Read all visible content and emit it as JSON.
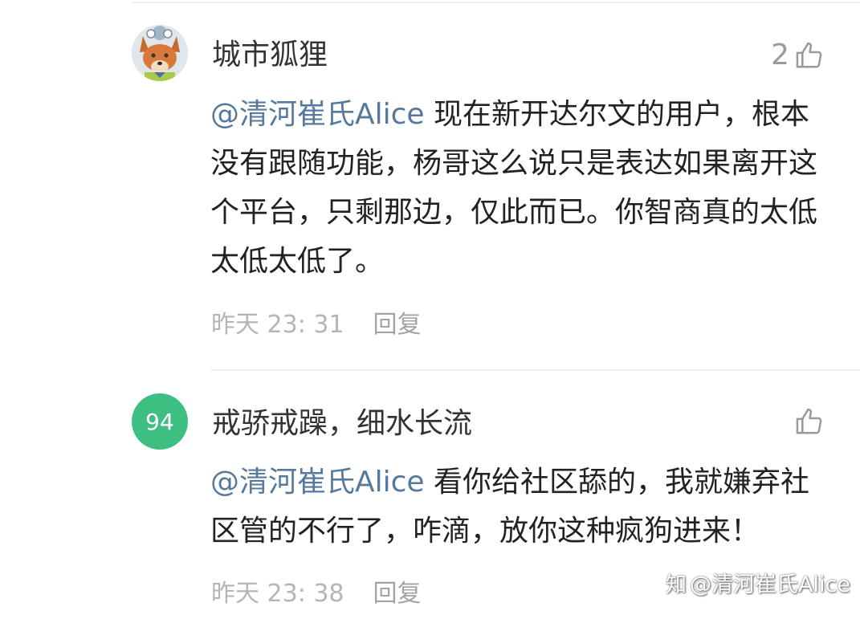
{
  "comments": [
    {
      "username": "城市狐狸",
      "avatar": "fox-avatar",
      "like_count": "2",
      "mention": "@清河崔氏Alice",
      "text": " 现在新开达尔文的用户，根本没有跟随功能，杨哥这么说只是表达如果离开这个平台，只剩那边，仅此而已。你智商真的太低太低太低了。",
      "time": "昨天 23: 31",
      "reply_label": "回复"
    },
    {
      "username": "戒骄戒躁，细水长流",
      "avatar_text": "94",
      "avatar_color": "#3dbf82",
      "like_count": "",
      "mention": "@清河崔氏Alice",
      "text": " 看你给社区舔的，我就嫌弃社区管的不行了，咋滴，放你这种疯狗进来！",
      "time": "昨天 23: 38",
      "reply_label": "回复"
    }
  ],
  "watermark": {
    "logo": "知",
    "text": "@清河崔氏Alice"
  },
  "colors": {
    "mention": "#56799e",
    "meta": "#b5b5b5",
    "badge": "#3dbf82"
  }
}
